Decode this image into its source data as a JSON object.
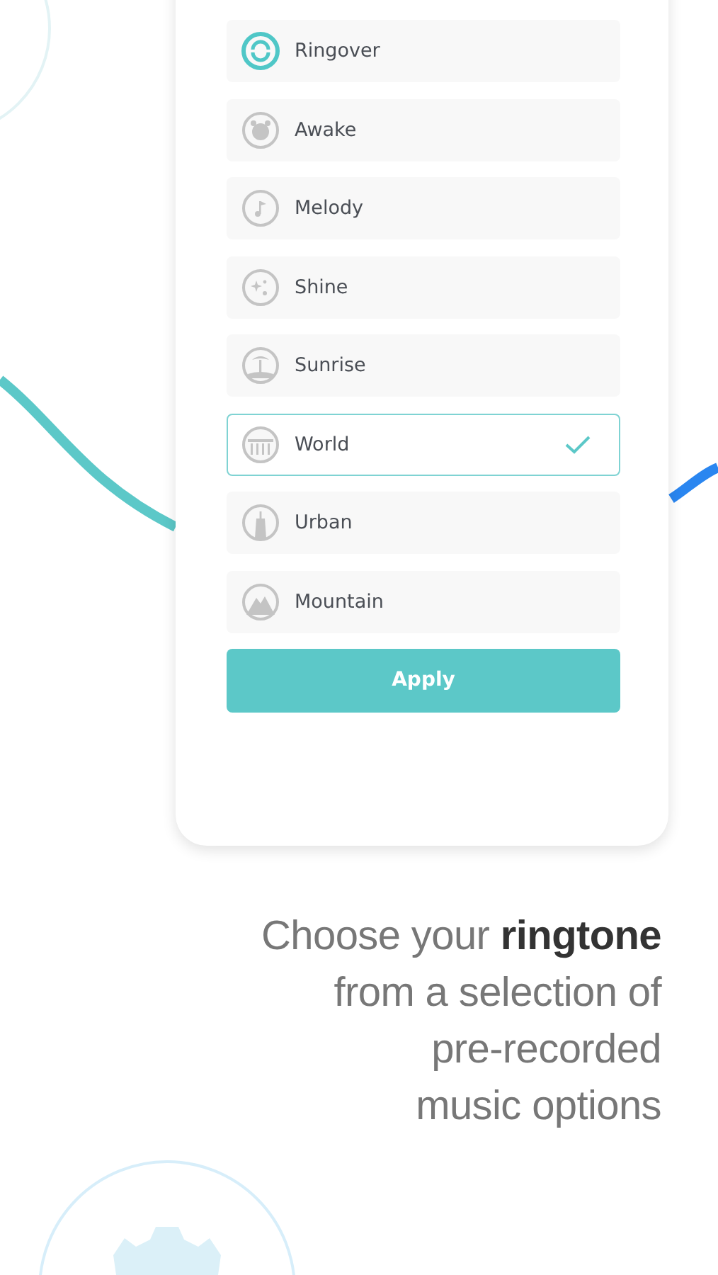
{
  "ringtones": [
    {
      "name": "Ringover",
      "selected": false
    },
    {
      "name": "Awake",
      "selected": false
    },
    {
      "name": "Melody",
      "selected": false
    },
    {
      "name": "Shine",
      "selected": false
    },
    {
      "name": "Sunrise",
      "selected": false
    },
    {
      "name": "World",
      "selected": true
    },
    {
      "name": "Urban",
      "selected": false
    },
    {
      "name": "Mountain",
      "selected": false
    }
  ],
  "apply_button": "Apply",
  "caption": "Choose your **ringtone**\nfrom a selection of\npre-recorded\nmusic options"
}
